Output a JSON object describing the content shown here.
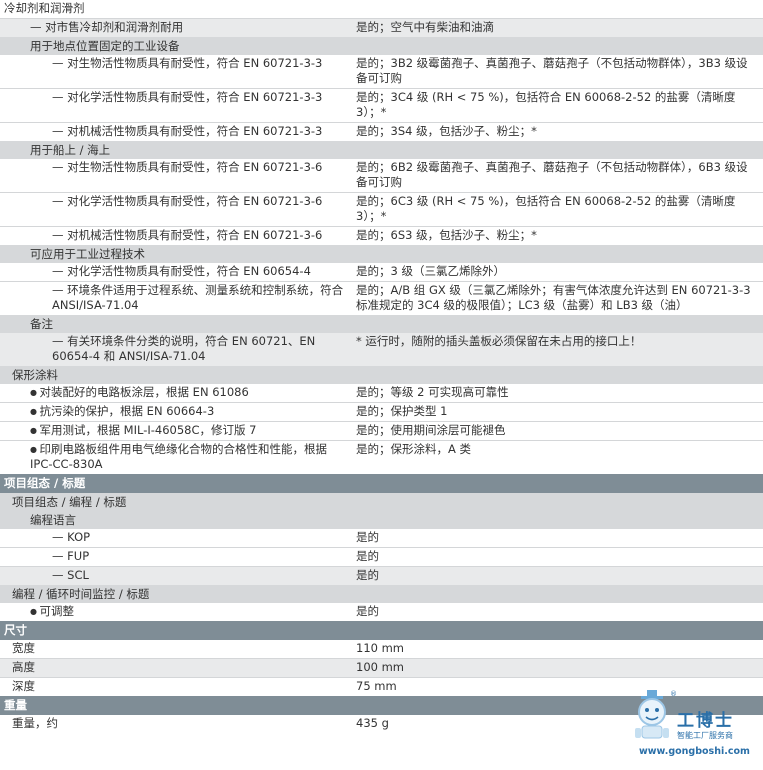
{
  "rows": [
    {
      "k": "row",
      "cls": "odd lv0",
      "l": "冷却剂和润滑剂",
      "r": ""
    },
    {
      "k": "row",
      "cls": "even lv2",
      "mark": "dash",
      "l": "对市售冷却剂和润滑剂耐用",
      "r": "是的；空气中有柴油和油滴"
    },
    {
      "k": "grp",
      "cls": "g2",
      "l": "用于地点位置固定的工业设备"
    },
    {
      "k": "row",
      "cls": "odd lv3",
      "mark": "dash",
      "l": "对生物活性物质具有耐受性，符合 EN 60721-3-3",
      "r": "是的；3B2 级霉菌孢子、真菌孢子、蘑菇孢子（不包括动物群体），3B3 级设备可订购"
    },
    {
      "k": "row",
      "cls": "odd lv3",
      "mark": "dash",
      "l": "对化学活性物质具有耐受性，符合 EN 60721-3-3",
      "r": "是的；3C4 级 (RH < 75 %)，包括符合 EN 60068-2-52 的盐雾（清晰度 3）；*"
    },
    {
      "k": "row",
      "cls": "odd lv3",
      "mark": "dash",
      "l": "对机械活性物质具有耐受性，符合 EN 60721-3-3",
      "r": "是的；3S4 级，包括沙子、粉尘；*"
    },
    {
      "k": "grp",
      "cls": "g2",
      "l": "用于船上 / 海上"
    },
    {
      "k": "row",
      "cls": "odd lv3",
      "mark": "dash",
      "l": "对生物活性物质具有耐受性，符合 EN 60721-3-6",
      "r": "是的；6B2 级霉菌孢子、真菌孢子、蘑菇孢子（不包括动物群体），6B3 级设备可订购"
    },
    {
      "k": "row",
      "cls": "odd lv3",
      "mark": "dash",
      "l": "对化学活性物质具有耐受性，符合 EN 60721-3-6",
      "r": "是的；6C3 级 (RH < 75 %)，包括符合 EN 60068-2-52 的盐雾（清晰度 3）；*"
    },
    {
      "k": "row",
      "cls": "odd lv3",
      "mark": "dash",
      "l": "对机械活性物质具有耐受性，符合 EN 60721-3-6",
      "r": "是的；6S3 级，包括沙子、粉尘；*"
    },
    {
      "k": "grp",
      "cls": "g2",
      "l": "可应用于工业过程技术"
    },
    {
      "k": "row",
      "cls": "odd lv3",
      "mark": "dash",
      "l": "对化学活性物质具有耐受性，符合 EN 60654-4",
      "r": "是的；3 级（三氯乙烯除外）"
    },
    {
      "k": "row",
      "cls": "odd lv3",
      "mark": "dash",
      "l": "环境条件适用于过程系统、测量系统和控制系统，符合 ANSI/ISA-71.04",
      "r": "是的；A/B 组 GX 级（三氯乙烯除外；有害气体浓度允许达到 EN 60721-3-3 标准规定的 3C4 级的极限值）；LC3 级（盐雾）和 LB3 级（油）"
    },
    {
      "k": "grp",
      "cls": "g2",
      "l": "备注"
    },
    {
      "k": "row",
      "cls": "even lv3",
      "mark": "dash",
      "l": "有关环境条件分类的说明，符合 EN 60721、EN 60654-4 和 ANSI/ISA-71.04",
      "r": "* 运行时，随附的插头盖板必须保留在未占用的接口上！"
    },
    {
      "k": "grp",
      "cls": "g1",
      "l": "保形涂料"
    },
    {
      "k": "row",
      "cls": "odd lvb",
      "mark": "bul",
      "l": "对装配好的电路板涂层，根据 EN 61086",
      "r": "是的；等级 2 可实现高可靠性"
    },
    {
      "k": "row",
      "cls": "odd lvb",
      "mark": "bul",
      "l": "抗污染的保护，根据 EN 60664-3",
      "r": "是的；保护类型 1"
    },
    {
      "k": "row",
      "cls": "odd lvb",
      "mark": "bul",
      "l": "军用测试，根据 MIL-I-46058C，修订版 7",
      "r": "是的；使用期间涂层可能褪色"
    },
    {
      "k": "row",
      "cls": "odd lvb",
      "mark": "bul",
      "l": "印刷电路板组件用电气绝缘化合物的合格性和性能，根据 IPC-CC-830A",
      "r": "是的；保形涂料，A 类"
    },
    {
      "k": "sec",
      "l": "项目组态 / 标题"
    },
    {
      "k": "grp",
      "cls": "g1",
      "l": "项目组态 / 编程 / 标题"
    },
    {
      "k": "grp",
      "cls": "g2",
      "l": "编程语言"
    },
    {
      "k": "row",
      "cls": "odd lv3",
      "mark": "dash",
      "l": "KOP",
      "r": "是的"
    },
    {
      "k": "row",
      "cls": "odd lv3",
      "mark": "dash",
      "l": "FUP",
      "r": "是的"
    },
    {
      "k": "row",
      "cls": "even lv3",
      "mark": "dash",
      "l": "SCL",
      "r": "是的"
    },
    {
      "k": "grp",
      "cls": "g1",
      "l": "编程 / 循环时间监控 / 标题"
    },
    {
      "k": "row",
      "cls": "odd lvb",
      "mark": "bul",
      "l": "可调整",
      "r": "是的"
    },
    {
      "k": "sec",
      "l": "尺寸"
    },
    {
      "k": "row",
      "cls": "odd lv1",
      "l": "宽度",
      "r": "110 mm"
    },
    {
      "k": "row",
      "cls": "even lv1",
      "l": "高度",
      "r": "100 mm"
    },
    {
      "k": "row",
      "cls": "odd lv1",
      "l": "深度",
      "r": "75 mm"
    },
    {
      "k": "sec",
      "l": "重量"
    },
    {
      "k": "row",
      "cls": "odd lv1",
      "l": "重量，约",
      "r": "435 g"
    }
  ],
  "logo": {
    "name": "工博士",
    "sub": "智能工厂服务商",
    "url": "www.gongboshi.com",
    "reg": "®"
  }
}
